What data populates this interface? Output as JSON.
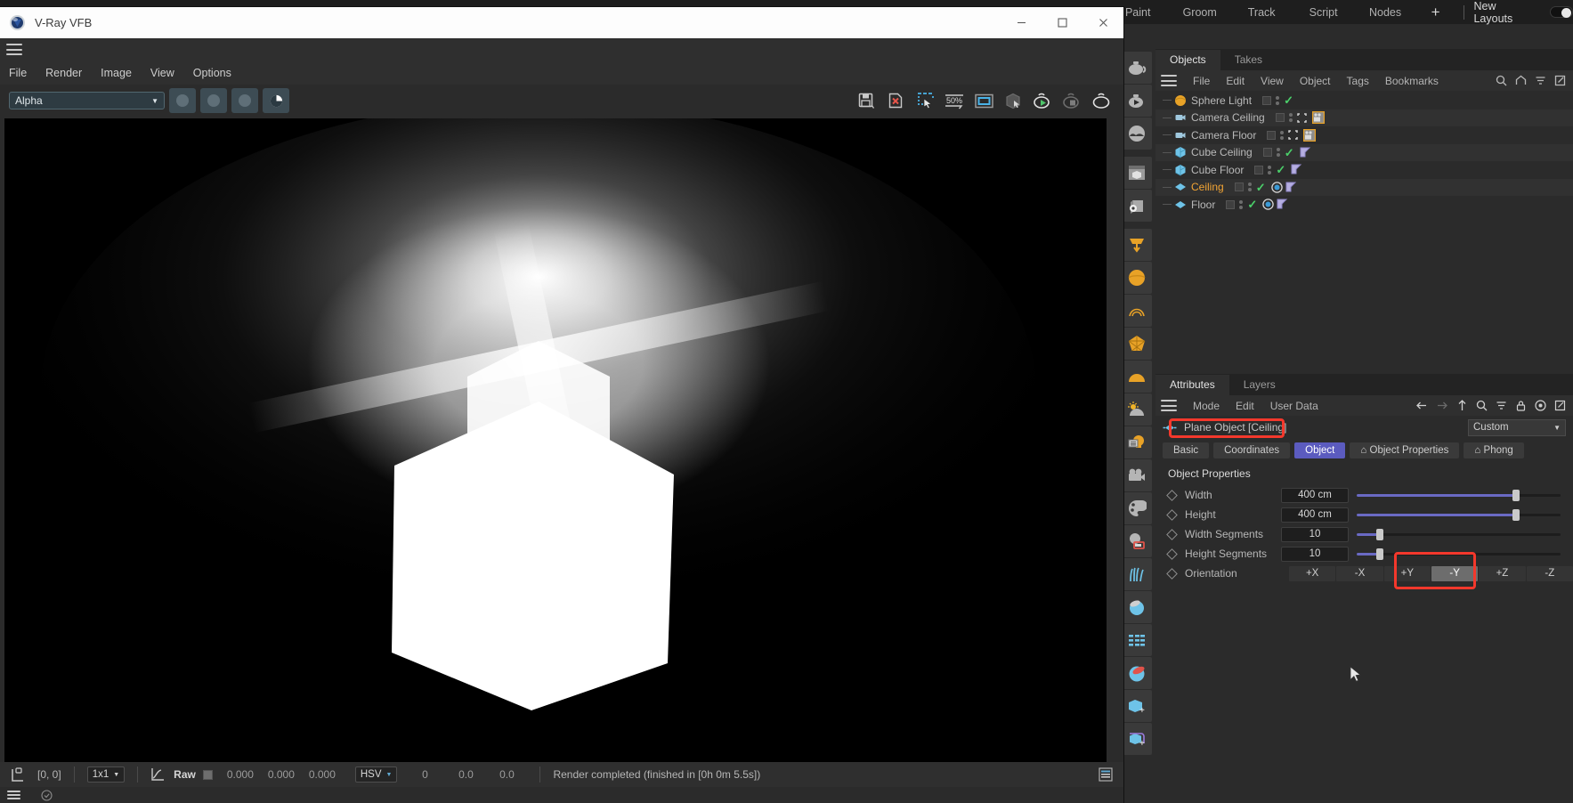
{
  "c4d": {
    "topmenu": {
      "items": [
        "Paint",
        "Groom",
        "Track",
        "Script",
        "Nodes"
      ],
      "plus": "+",
      "layout_label": "New Layouts"
    },
    "object_manager": {
      "tabs": [
        {
          "label": "Objects",
          "active": true
        },
        {
          "label": "Takes",
          "active": false
        }
      ],
      "menu": [
        "File",
        "Edit",
        "View",
        "Object",
        "Tags",
        "Bookmarks"
      ],
      "icons": [
        "search-icon",
        "home-icon",
        "filter-icon",
        "popout-icon"
      ],
      "objects": [
        {
          "name": "Sphere Light",
          "type": "light",
          "selected": false,
          "tags": []
        },
        {
          "name": "Camera Ceiling",
          "type": "camera",
          "selected": false,
          "tags": [
            "camera-tag"
          ]
        },
        {
          "name": "Camera Floor",
          "type": "camera",
          "selected": false,
          "tags": [
            "camera-tag"
          ]
        },
        {
          "name": "Cube Ceiling",
          "type": "cube",
          "selected": false,
          "tags": [
            "phong-tag"
          ]
        },
        {
          "name": "Cube Floor",
          "type": "cube",
          "selected": false,
          "tags": [
            "phong-tag"
          ]
        },
        {
          "name": "Ceiling",
          "type": "plane",
          "selected": true,
          "tags": [
            "vray-tag",
            "phong-tag"
          ]
        },
        {
          "name": "Floor",
          "type": "plane",
          "selected": false,
          "tags": [
            "vray-tag",
            "phong-tag"
          ]
        }
      ]
    },
    "attributes": {
      "tabs": [
        {
          "label": "Attributes",
          "active": true
        },
        {
          "label": "Layers",
          "active": false
        }
      ],
      "menu": [
        "Mode",
        "Edit",
        "User Data"
      ],
      "icons": [
        "back-arrow-icon",
        "forward-arrow-icon",
        "up-arrow-icon",
        "search-icon",
        "filter-icon",
        "lock-icon",
        "record-icon",
        "popout-icon"
      ],
      "object_name": "Plane Object [Ceiling]",
      "preset": "Custom",
      "tabs_row": [
        {
          "label": "Basic",
          "active": false
        },
        {
          "label": "Coordinates",
          "active": false
        },
        {
          "label": "Object",
          "active": true
        },
        {
          "label": "⌂ Object Properties",
          "active": false
        },
        {
          "label": "⌂ Phong",
          "active": false
        }
      ],
      "section_title": "Object Properties",
      "properties": [
        {
          "label": "Width",
          "value": "400 cm",
          "slider": 73
        },
        {
          "label": "Height",
          "value": "400 cm",
          "slider": 73
        },
        {
          "label": "Width Segments",
          "value": "10",
          "slider": 10
        },
        {
          "label": "Height Segments",
          "value": "10",
          "slider": 10
        }
      ],
      "orientation_label": "Orientation",
      "orientation_options": [
        "+X",
        "-X",
        "+Y",
        "-Y",
        "+Z",
        "-Z"
      ],
      "orientation_selected": "-Y"
    }
  },
  "vfb": {
    "title": "V-Ray VFB",
    "window_buttons": [
      "minimize-button",
      "maximize-button",
      "close-button"
    ],
    "menu": [
      "File",
      "Render",
      "Image",
      "View",
      "Options"
    ],
    "channel": "Alpha",
    "toolbar_icons": [
      "save-image-icon",
      "clear-image-icon",
      "region-render-icon",
      "zoom-50-percent-icon",
      "fit-to-window-icon",
      "render-region-icon",
      "render-start-icon",
      "render-stop-icon",
      "render-last-icon"
    ],
    "zoom_label": "50%",
    "statusbar": {
      "coords": "[0, 0]",
      "ratio": "1x1",
      "mode": "Raw",
      "rgb": [
        "0.000",
        "0.000",
        "0.000"
      ],
      "colorspace": "HSV",
      "hsv": [
        "0",
        "0.0",
        "0.0"
      ],
      "status": "Render completed (finished in [0h  0m  5.5s])"
    }
  },
  "annotations": {
    "highlight_object_name": "Plane Object [Ceiling]",
    "highlight_orientation": "-Y",
    "color": "#f4382c"
  }
}
